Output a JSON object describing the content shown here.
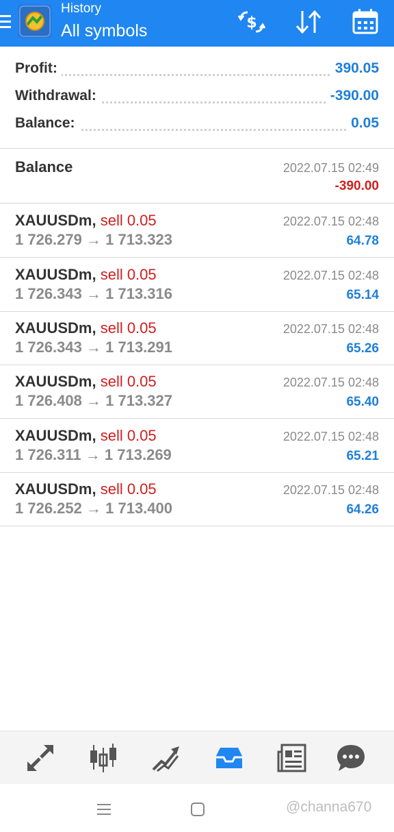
{
  "header": {
    "subtitle": "History",
    "title": "All symbols",
    "icons": [
      "menu-icon",
      "app-logo",
      "currency-exchange-icon",
      "sort-icon",
      "calendar-icon"
    ]
  },
  "summary": {
    "profit": {
      "label": "Profit:",
      "value": "390.05"
    },
    "withdrawal": {
      "label": "Withdrawal:",
      "value": "-390.00"
    },
    "balance": {
      "label": "Balance:",
      "value": "0.05"
    }
  },
  "balance_entry": {
    "label": "Balance",
    "time": "2022.07.15 02:49",
    "amount": "-390.00"
  },
  "deals": [
    {
      "symbol": "XAUUSDm,",
      "side": "sell 0.05",
      "open": "1 726.279",
      "arrow": "→",
      "close": "1 713.323",
      "time": "2022.07.15 02:48",
      "profit": "64.78"
    },
    {
      "symbol": "XAUUSDm,",
      "side": "sell 0.05",
      "open": "1 726.343",
      "arrow": "→",
      "close": "1 713.316",
      "time": "2022.07.15 02:48",
      "profit": "65.14"
    },
    {
      "symbol": "XAUUSDm,",
      "side": "sell 0.05",
      "open": "1 726.343",
      "arrow": "→",
      "close": "1 713.291",
      "time": "2022.07.15 02:48",
      "profit": "65.26"
    },
    {
      "symbol": "XAUUSDm,",
      "side": "sell 0.05",
      "open": "1 726.408",
      "arrow": "→",
      "close": "1 713.327",
      "time": "2022.07.15 02:48",
      "profit": "65.40"
    },
    {
      "symbol": "XAUUSDm,",
      "side": "sell 0.05",
      "open": "1 726.311",
      "arrow": "→",
      "close": "1 713.269",
      "time": "2022.07.15 02:48",
      "profit": "65.21"
    },
    {
      "symbol": "XAUUSDm,",
      "side": "sell 0.05",
      "open": "1 726.252",
      "arrow": "→",
      "close": "1 713.400",
      "time": "2022.07.15 02:48",
      "profit": "64.26"
    }
  ],
  "bottom_nav": {
    "items": [
      "quotes-icon",
      "chart-icon",
      "trade-icon",
      "history-icon",
      "news-icon",
      "chat-icon"
    ],
    "active": "history-icon",
    "active_color": "#1f86f2",
    "inactive_color": "#555555"
  },
  "system_bar": {
    "icons": [
      "recents-icon",
      "home-icon"
    ],
    "watermark": "@channa670"
  },
  "colors": {
    "header_bg": "#1f86f2",
    "positive": "#1f7fd8",
    "negative": "#d01e1e"
  }
}
